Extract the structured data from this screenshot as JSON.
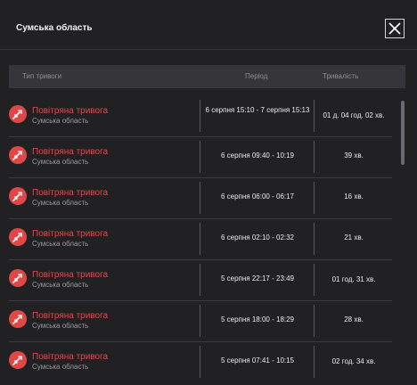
{
  "modal": {
    "title": "Сумська область"
  },
  "table": {
    "headers": {
      "type": "Тип тривоги",
      "period": "Період",
      "duration": "Тривалість"
    },
    "rows": [
      {
        "type": "Повітряна тривога",
        "region": "Сумська область",
        "period": "6 серпня 15:10 - 7 серпня 15:13",
        "duration": "01 д. 04 год. 02 хв."
      },
      {
        "type": "Повітряна тривога",
        "region": "Сумська область",
        "period": "6 серпня 09:40 - 10:19",
        "duration": "39 хв."
      },
      {
        "type": "Повітряна тривога",
        "region": "Сумська область",
        "period": "6 серпня 06:00 - 06:17",
        "duration": "16 хв."
      },
      {
        "type": "Повітряна тривога",
        "region": "Сумська область",
        "period": "6 серпня 02:10 - 02:32",
        "duration": "21 хв."
      },
      {
        "type": "Повітряна тривога",
        "region": "Сумська область",
        "period": "5 серпня 22:17 - 23:49",
        "duration": "01 год. 31 хв."
      },
      {
        "type": "Повітряна тривога",
        "region": "Сумська область",
        "period": "5 серпня 18:00 - 18:29",
        "duration": "28 хв."
      },
      {
        "type": "Повітряна тривога",
        "region": "Сумська область",
        "period": "5 серпня 07:41 - 10:15",
        "duration": "02 год. 34 хв."
      }
    ]
  },
  "colors": {
    "alert": "#e04848",
    "background": "#212124",
    "header_bg": "#35353a"
  },
  "icons": {
    "close": "close-icon",
    "alert": "rocket-icon"
  }
}
